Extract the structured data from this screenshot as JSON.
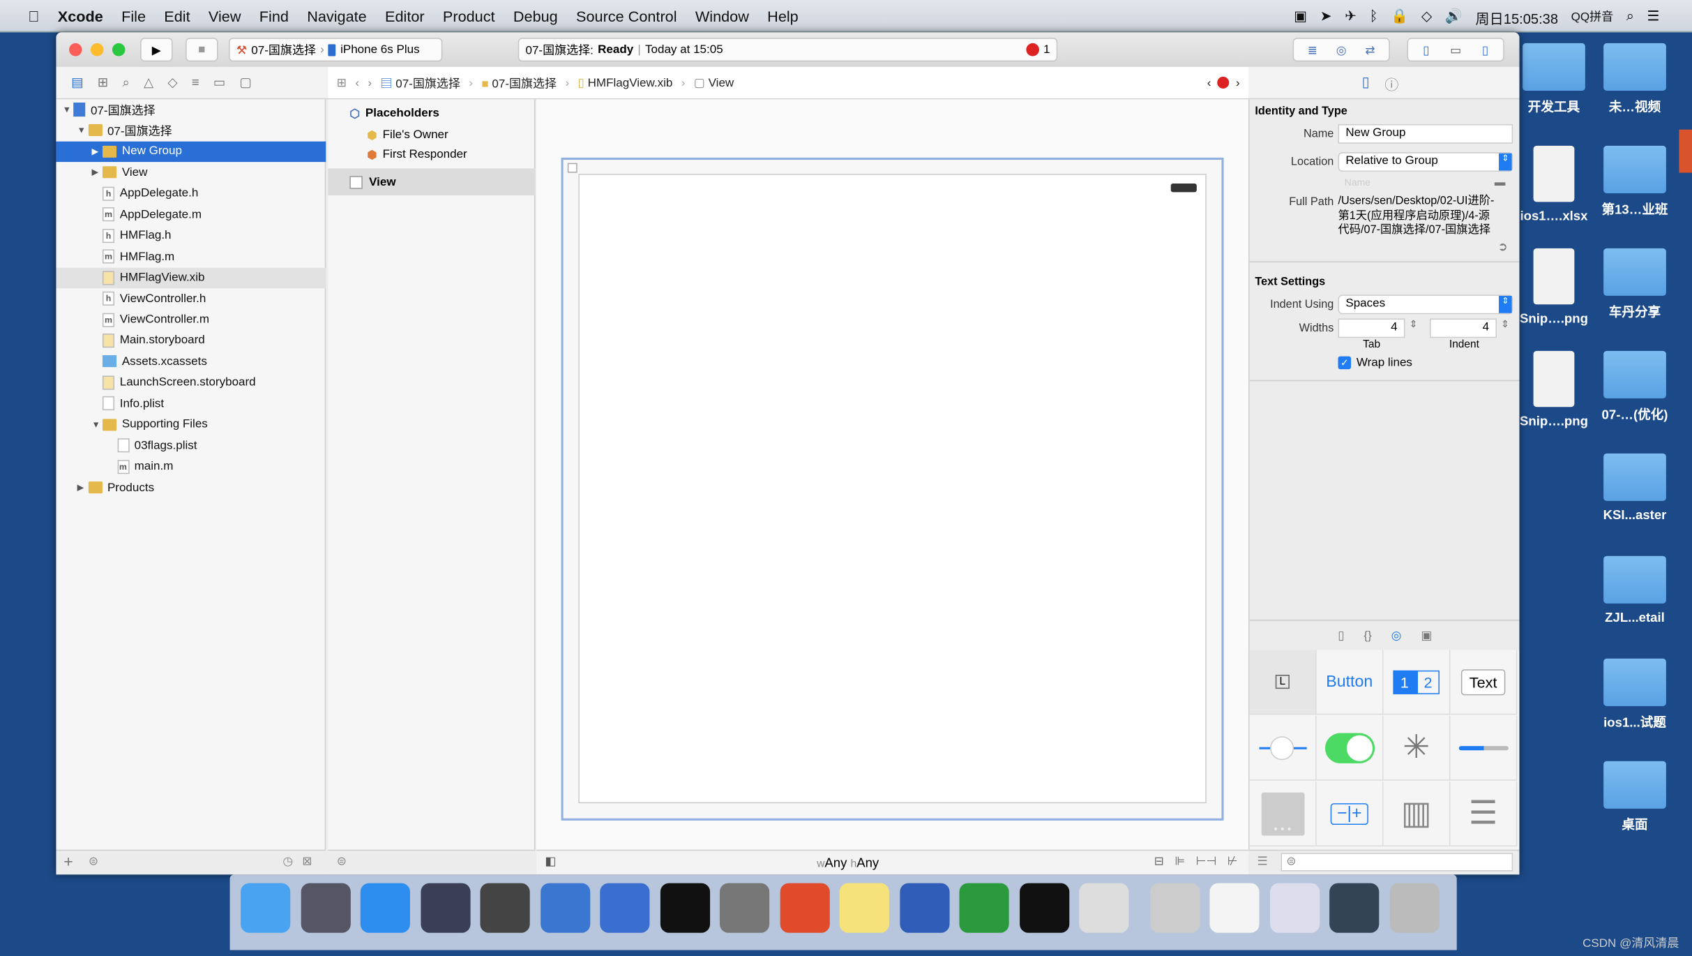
{
  "menubar": {
    "apple": "",
    "items": [
      "Xcode",
      "File",
      "Edit",
      "View",
      "Find",
      "Navigate",
      "Editor",
      "Product",
      "Debug",
      "Source Control",
      "Window",
      "Help"
    ],
    "clock": "周日15:05:38",
    "input_method": "QQ拼音"
  },
  "toolbar": {
    "scheme": "07-国旗选择",
    "device": "iPhone 6s Plus",
    "status_project": "07-国旗选择:",
    "status_state": "Ready",
    "status_time": "Today at 15:05",
    "error_count": "1"
  },
  "jumpbar": [
    "07-国旗选择",
    "07-国旗选择",
    "HMFlagView.xib",
    "View"
  ],
  "navigator": {
    "items": [
      {
        "label": "07-国旗选择",
        "indent": 0,
        "type": "project",
        "disclosure": "open"
      },
      {
        "label": "07-国旗选择",
        "indent": 1,
        "type": "folder",
        "disclosure": "open"
      },
      {
        "label": "New Group",
        "indent": 2,
        "type": "folder",
        "disclosure": "closed",
        "selected": true
      },
      {
        "label": "View",
        "indent": 2,
        "type": "folder",
        "disclosure": "closed"
      },
      {
        "label": "AppDelegate.h",
        "indent": 2,
        "type": "h"
      },
      {
        "label": "AppDelegate.m",
        "indent": 2,
        "type": "m"
      },
      {
        "label": "HMFlag.h",
        "indent": 2,
        "type": "h"
      },
      {
        "label": "HMFlag.m",
        "indent": 2,
        "type": "m"
      },
      {
        "label": "HMFlagView.xib",
        "indent": 2,
        "type": "xib",
        "highlighted": true
      },
      {
        "label": "ViewController.h",
        "indent": 2,
        "type": "h"
      },
      {
        "label": "ViewController.m",
        "indent": 2,
        "type": "m"
      },
      {
        "label": "Main.storyboard",
        "indent": 2,
        "type": "sb"
      },
      {
        "label": "Assets.xcassets",
        "indent": 2,
        "type": "assets"
      },
      {
        "label": "LaunchScreen.storyboard",
        "indent": 2,
        "type": "sb"
      },
      {
        "label": "Info.plist",
        "indent": 2,
        "type": "plist"
      },
      {
        "label": "Supporting Files",
        "indent": 2,
        "type": "folder",
        "disclosure": "open"
      },
      {
        "label": "03flags.plist",
        "indent": 3,
        "type": "plist"
      },
      {
        "label": "main.m",
        "indent": 3,
        "type": "m"
      },
      {
        "label": "Products",
        "indent": 1,
        "type": "folder",
        "disclosure": "closed"
      }
    ]
  },
  "outline": {
    "placeholders": "Placeholders",
    "files_owner": "File's Owner",
    "first_responder": "First Responder",
    "view": "View"
  },
  "canvas": {
    "size_class_w": "w",
    "size_class_any1": "Any",
    "size_class_h": "h",
    "size_class_any2": "Any"
  },
  "inspector": {
    "identity_title": "Identity and Type",
    "name_label": "Name",
    "name_value": "New Group",
    "location_label": "Location",
    "location_value": "Relative to Group",
    "name_placeholder": "Name",
    "fullpath_label": "Full Path",
    "fullpath_value": "/Users/sen/Desktop/02-UI进阶-第1天(应用程序启动原理)/4-源代码/07-国旗选择/07-国旗选择",
    "text_settings_title": "Text Settings",
    "indent_label": "Indent Using",
    "indent_value": "Spaces",
    "widths_label": "Widths",
    "tab_value": "4",
    "indent_width_value": "4",
    "tab_label": "Tab",
    "indent_sub_label": "Indent",
    "wrap_label": "Wrap lines",
    "wrap_checked": true
  },
  "library": {
    "label_item": "L",
    "button_item": "Button",
    "seg1": "1",
    "seg2": "2",
    "text_item": "Text"
  },
  "desktop": [
    "开发工具",
    "未…视频",
    "ios1….xlsx",
    "第13…业班",
    "Snip….png",
    "车丹分享",
    "Snip….png",
    "07-…(优化)",
    "KSI...aster",
    "ZJL...etail",
    "ios1...试题",
    "桌面"
  ],
  "dock": [
    "finder",
    "launchpad",
    "safari",
    "mouse",
    "photo-booth",
    "xcode",
    "instruments",
    "terminal",
    "system-preferences",
    "powerpoint",
    "notes",
    "word",
    "excel",
    "console",
    "preview",
    "screenshot",
    "textedit",
    "finder-window",
    "display",
    "trash"
  ],
  "watermark": "CSDN @清风清晨",
  "colors": {
    "selection": "#2a6fd6",
    "desktop": "#1c4a88",
    "accent": "#1f7cf2"
  }
}
